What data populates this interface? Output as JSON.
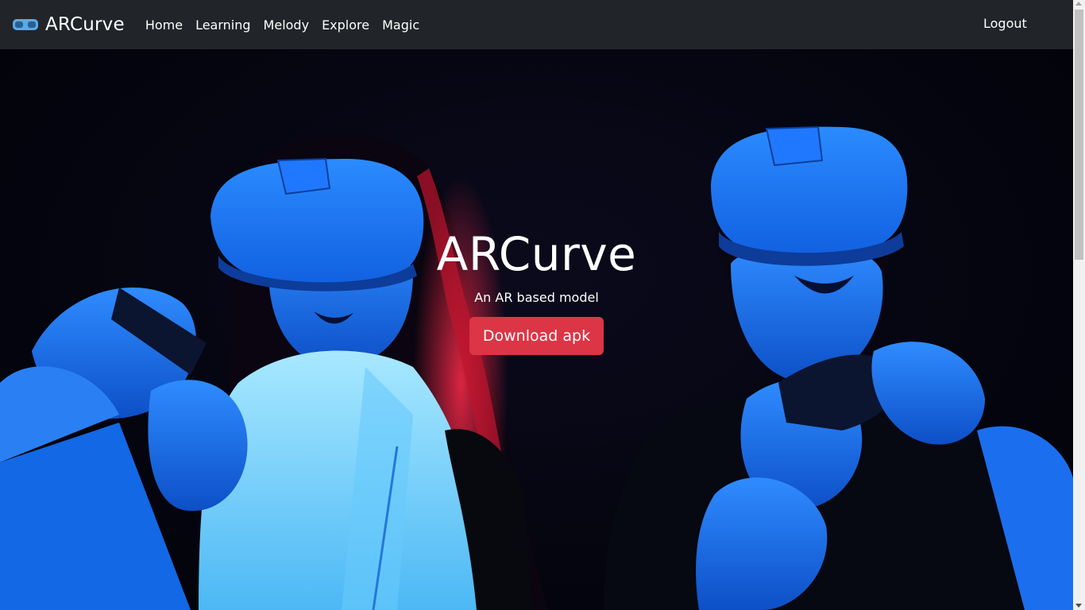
{
  "navbar": {
    "brand": "ARCurve",
    "links": [
      "Home",
      "Learning",
      "Melody",
      "Explore",
      "Magic"
    ],
    "logout": "Logout"
  },
  "hero": {
    "title": "ARCurve",
    "subtitle": "An AR based model",
    "button": "Download apk"
  },
  "colors": {
    "navbar_bg": "#212529",
    "button_bg": "#dc3545",
    "headset_blue": "#1e7bff"
  },
  "icons": {
    "brand": "vr-headset-icon"
  }
}
